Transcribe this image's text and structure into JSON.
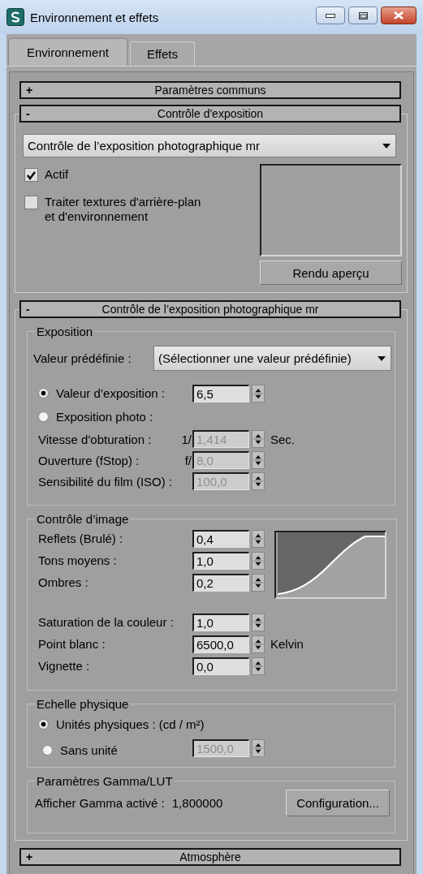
{
  "window": {
    "title": "Environnement et effets"
  },
  "tabs": [
    {
      "label": "Environnement",
      "selected": true
    },
    {
      "label": "Effets",
      "selected": false
    }
  ],
  "rollouts": [
    {
      "toggle": "+",
      "title": "Paramètres communs"
    },
    {
      "toggle": "-",
      "title": "Contrôle d'exposition",
      "kind": "exposure_control",
      "dropdown": {
        "value": "Contrôle de l’exposition photographique mr"
      },
      "checkboxes": [
        {
          "label": "Actif",
          "checked": true
        },
        {
          "label": "Traiter textures d'arrière-plan et d'environnement",
          "checked": false
        }
      ],
      "preview_button": "Rendu aperçu"
    },
    {
      "toggle": "-",
      "title": "Contrôle de l’exposition photographique mr",
      "kind": "groups",
      "groups": [
        {
          "kind": "exposure",
          "title": "Exposition",
          "preset": {
            "label": "Valeur prédéfinie :",
            "value": "(Sélectionner une valeur prédéfinie)"
          },
          "rows": [
            {
              "kind": "radio",
              "label": "Valeur d’exposition :",
              "selected": true,
              "field": {
                "value": "6,5",
                "disabled": false
              }
            },
            {
              "kind": "radio",
              "label": "Exposition photo :",
              "selected": false
            },
            {
              "kind": "spinner",
              "label": "Vitesse d'obturation :",
              "prefix": "1/",
              "field": {
                "value": "1,414",
                "disabled": true
              },
              "unit": "Sec."
            },
            {
              "kind": "spinner",
              "label": "Ouverture (fStop) :",
              "prefix": "f/",
              "field": {
                "value": "8,0",
                "disabled": true
              }
            },
            {
              "kind": "spinner",
              "label": "Sensibilité du film (ISO) :",
              "field": {
                "value": "100,0",
                "disabled": true
              }
            }
          ]
        },
        {
          "kind": "image_control",
          "title": "Contrôle d’image",
          "rows": [
            {
              "kind": "spinner",
              "label": "Reflets (Brulé) :",
              "field": {
                "value": "0,4",
                "disabled": false
              }
            },
            {
              "kind": "spinner",
              "label": "Tons moyens :",
              "field": {
                "value": "1,0",
                "disabled": false
              }
            },
            {
              "kind": "spinner",
              "label": "Ombres :",
              "field": {
                "value": "0,2",
                "disabled": false
              }
            }
          ],
          "rows_2": [
            {
              "kind": "spinner",
              "label": "Saturation de la couleur :",
              "field": {
                "value": "1,0",
                "disabled": false
              }
            },
            {
              "kind": "spinner",
              "label": "Point blanc :",
              "field": {
                "value": "6500,0",
                "disabled": false
              },
              "unit": "Kelvin"
            },
            {
              "kind": "spinner",
              "label": "Vignette :",
              "field": {
                "value": "0,0",
                "disabled": false
              }
            }
          ]
        },
        {
          "kind": "physical_scale",
          "title": "Echelle physique",
          "rows": [
            {
              "kind": "radio",
              "label": "Unités physiques : (cd / m²)",
              "selected": true
            },
            {
              "kind": "radio",
              "label": "Sans unité",
              "selected": false,
              "field": {
                "value": "1500,0",
                "disabled": true
              }
            }
          ]
        },
        {
          "kind": "gamma",
          "title": "Paramètres Gamma/LUT",
          "label": "Afficher Gamma activé :",
          "value": "1,800000",
          "button": "Configuration..."
        }
      ]
    },
    {
      "toggle": "+",
      "title": "Atmosphère"
    }
  ]
}
